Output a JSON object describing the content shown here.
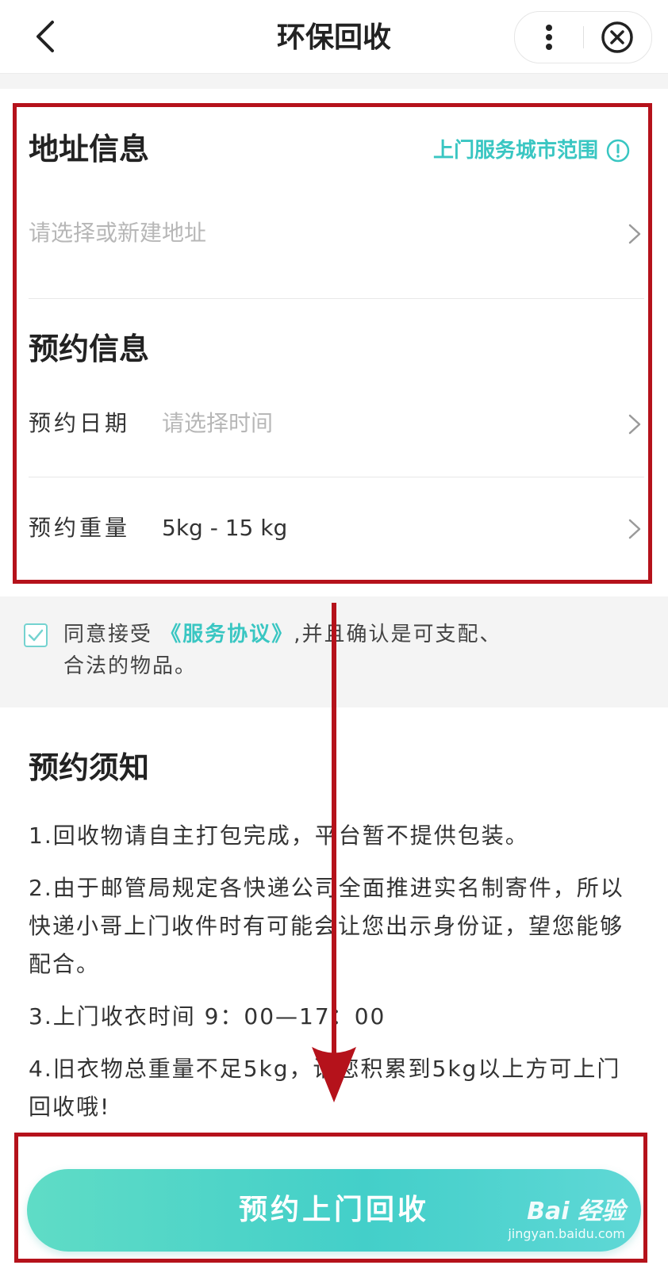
{
  "header": {
    "title": "环保回收"
  },
  "address": {
    "section_title": "地址信息",
    "city_range_link": "上门服务城市范围",
    "placeholder": "请选择或新建地址"
  },
  "booking": {
    "section_title": "预约信息",
    "date_label": "预约日期",
    "date_placeholder": "请选择时间",
    "weight_label": "预约重量",
    "weight_value": "5kg - 15 kg"
  },
  "agreement": {
    "checked": true,
    "prefix": "同意接受 ",
    "link_text": "《服务协议》",
    "suffix": ",并且确认是可支配、合法的物品。"
  },
  "notice": {
    "title": "预约须知",
    "items": [
      "1.回收物请自主打包完成，平台暂不提供包装。",
      "2.由于邮管局规定各快递公司全面推进实名制寄件，所以快递小哥上门收件时有可能会让您出示身份证，望您能够配合。",
      "3.上门收衣时间 9：00—17：00",
      "4.旧衣物总重量不足5kg，请您积累到5kg以上方可上门回收哦!"
    ]
  },
  "cta": {
    "label": "预约上门回收"
  },
  "watermark": {
    "main": "Bai 经验",
    "sub": "jingyan.baidu.com"
  },
  "colors": {
    "accent": "#39c6c2",
    "annotation": "#b5121b",
    "placeholder": "#b7b7b7"
  }
}
